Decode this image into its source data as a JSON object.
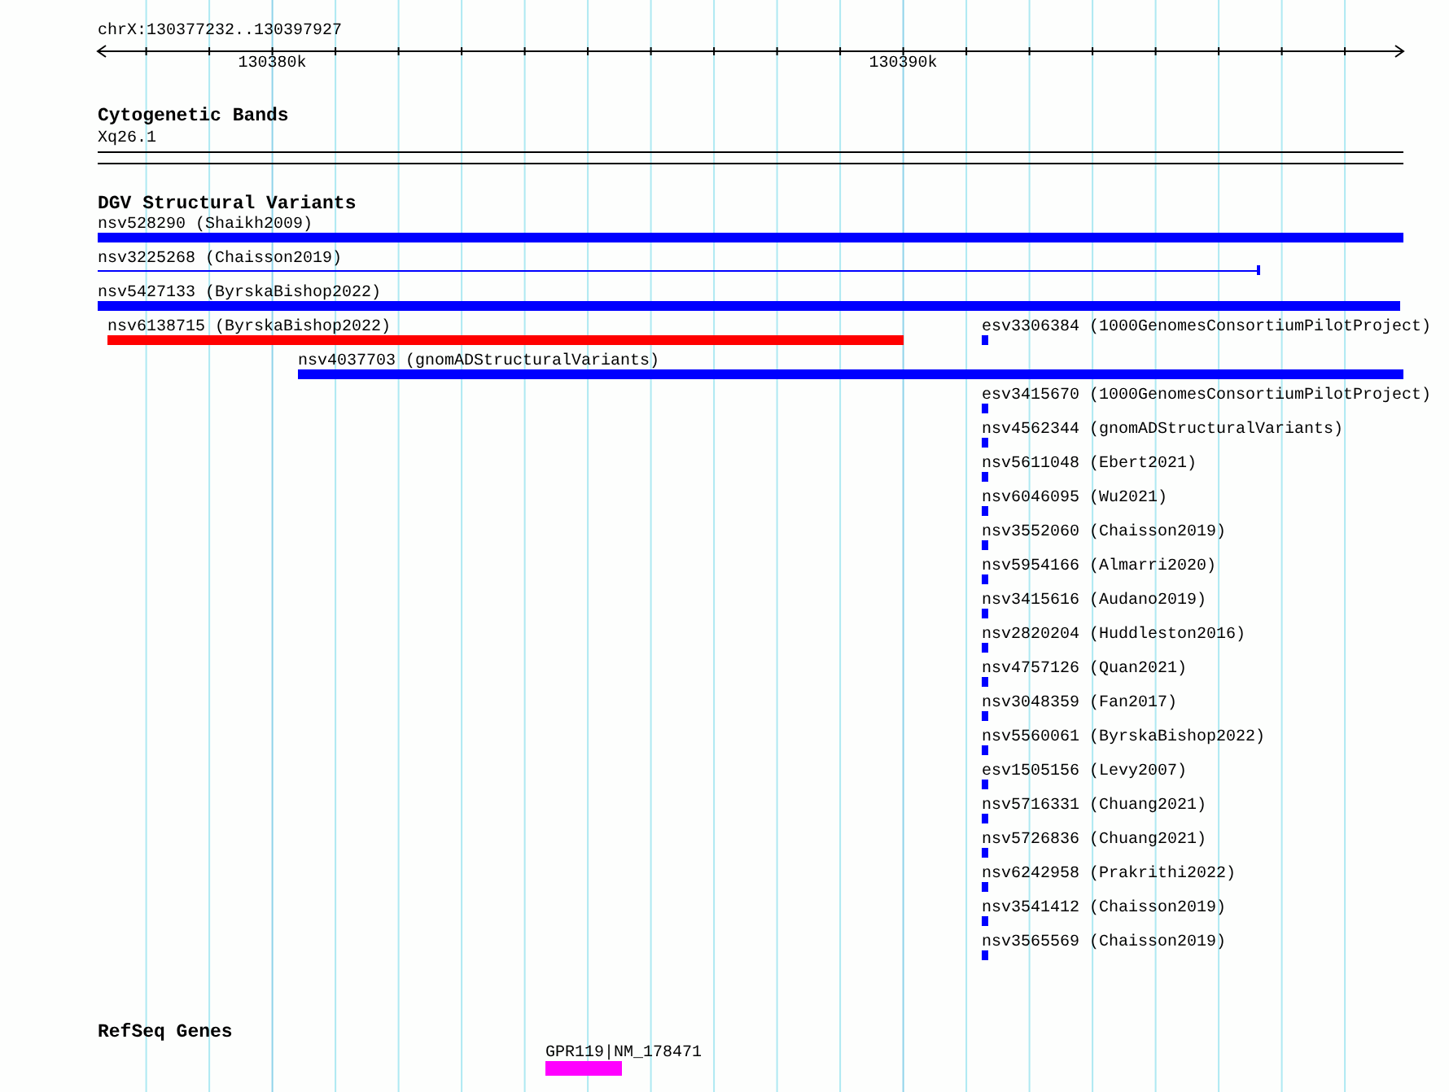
{
  "ruler": {
    "location": "chrX:130377232..130397927",
    "ticks": [
      {
        "label": "130380k"
      },
      {
        "label": "130390k"
      }
    ]
  },
  "tracks": [
    {
      "kind": "cytoband",
      "title": "Cytogenetic Bands",
      "features": [
        {
          "label": "Xq26.1"
        }
      ]
    },
    {
      "kind": "variants",
      "title": "DGV Structural Variants",
      "features": [
        {
          "label": "nsv528290 (Shaikh2009)",
          "kind": "bar",
          "color": "#0000ff"
        },
        {
          "label": "nsv3225268 (Chaisson2019)",
          "kind": "line",
          "color": "#0000ff"
        },
        {
          "label": "nsv5427133 (ByrskaBishop2022)",
          "kind": "bar",
          "color": "#0000ff"
        },
        {
          "label": "nsv6138715 (ByrskaBishop2022)",
          "kind": "bar",
          "color": "#ff0000"
        },
        {
          "label": "esv3306384 (1000GenomesConsortiumPilotProject)",
          "kind": "bar",
          "color": "#0000ff"
        },
        {
          "label": "nsv4037703 (gnomADStructuralVariants)",
          "kind": "bar",
          "color": "#0000ff"
        },
        {
          "label": "esv3415670 (1000GenomesConsortiumPilotProject)",
          "kind": "bar",
          "color": "#0000ff"
        },
        {
          "label": "nsv4562344 (gnomADStructuralVariants)",
          "kind": "bar",
          "color": "#0000ff"
        },
        {
          "label": "nsv5611048 (Ebert2021)",
          "kind": "bar",
          "color": "#0000ff"
        },
        {
          "label": "nsv6046095 (Wu2021)",
          "kind": "bar",
          "color": "#0000ff"
        },
        {
          "label": "nsv3552060 (Chaisson2019)",
          "kind": "bar",
          "color": "#0000ff"
        },
        {
          "label": "nsv5954166 (Almarri2020)",
          "kind": "bar",
          "color": "#0000ff"
        },
        {
          "label": "nsv3415616 (Audano2019)",
          "kind": "bar",
          "color": "#0000ff"
        },
        {
          "label": "nsv2820204 (Huddleston2016)",
          "kind": "bar",
          "color": "#0000ff"
        },
        {
          "label": "nsv4757126 (Quan2021)",
          "kind": "bar",
          "color": "#0000ff"
        },
        {
          "label": "nsv3048359 (Fan2017)",
          "kind": "bar",
          "color": "#0000ff"
        },
        {
          "label": "nsv5560061 (ByrskaBishop2022)",
          "kind": "bar",
          "color": "#0000ff"
        },
        {
          "label": "esv1505156 (Levy2007)",
          "kind": "bar",
          "color": "#0000ff"
        },
        {
          "label": "nsv5716331 (Chuang2021)",
          "kind": "bar",
          "color": "#0000ff"
        },
        {
          "label": "nsv5726836 (Chuang2021)",
          "kind": "bar",
          "color": "#0000ff"
        },
        {
          "label": "nsv6242958 (Prakrithi2022)",
          "kind": "bar",
          "color": "#0000ff"
        },
        {
          "label": "nsv3541412 (Chaisson2019)",
          "kind": "bar",
          "color": "#0000ff"
        },
        {
          "label": "nsv3565569 (Chaisson2019)",
          "kind": "bar",
          "color": "#0000ff"
        }
      ]
    },
    {
      "kind": "genes",
      "title": "RefSeq Genes",
      "features": [
        {
          "label": "GPR119|NM_178471",
          "kind": "bar",
          "color": "#ff00ff"
        }
      ]
    }
  ]
}
